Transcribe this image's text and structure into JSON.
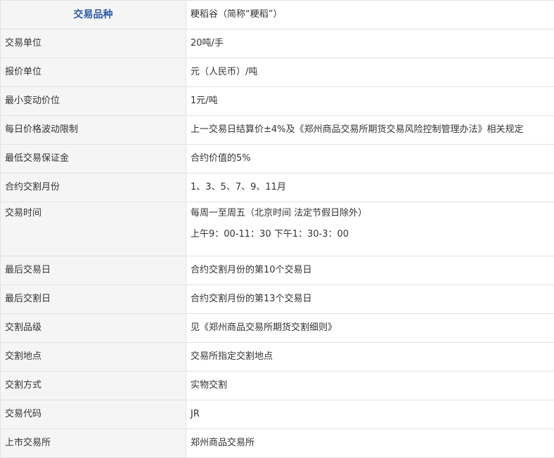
{
  "table": {
    "rows": [
      {
        "label": "交易品种",
        "value": "粳稻谷（简称“粳稻”）"
      },
      {
        "label": "交易单位",
        "value": "20吨/手"
      },
      {
        "label": "报价单位",
        "value": "元（人民币）/吨"
      },
      {
        "label": "最小变动价位",
        "value": "1元/吨"
      },
      {
        "label": "每日价格波动限制",
        "value": "上一交易日结算价±4%及《郑州商品交易所期货交易风险控制管理办法》相关规定"
      },
      {
        "label": "最低交易保证金",
        "value": "合约价值的5%"
      },
      {
        "label": "合约交割月份",
        "value": "1、3、5、7、9、11月"
      },
      {
        "label": "交易时间",
        "value": "每周一至周五（北京时间 法定节假日除外）",
        "value2": "上午9：00-11：30 下午1：30-3：00"
      },
      {
        "label": "最后交易日",
        "value": "合约交割月份的第10个交易日"
      },
      {
        "label": "最后交割日",
        "value": "合约交割月份的第13个交易日"
      },
      {
        "label": "交割品级",
        "value": "见《郑州商品交易所期货交割细则》"
      },
      {
        "label": "交割地点",
        "value": "交易所指定交割地点"
      },
      {
        "label": "交割方式",
        "value": "实物交割"
      },
      {
        "label": "交易代码",
        "value": "JR"
      },
      {
        "label": "上市交易所",
        "value": "郑州商品交易所"
      }
    ]
  },
  "colors": {
    "header_text": "#2a5aa8",
    "label_bg": "#f5f5f5",
    "border": "#e2e2e2",
    "text": "#333333"
  }
}
